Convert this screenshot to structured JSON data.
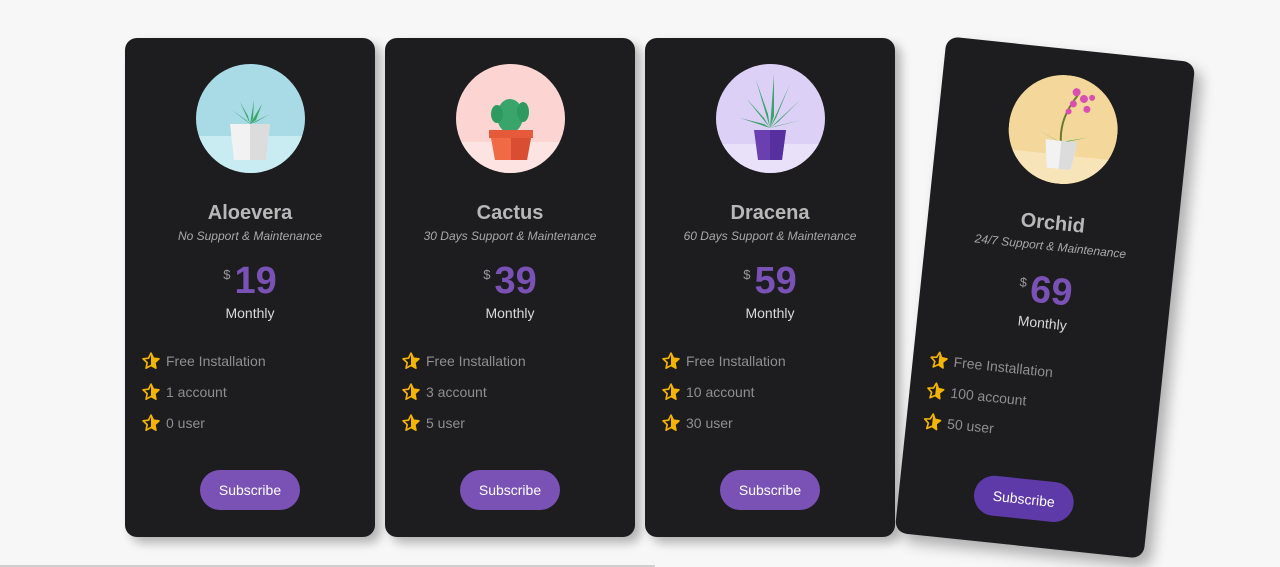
{
  "colors": {
    "card_bg": "#1d1c1e",
    "accent": "#7a52b5",
    "star": "#f5b400"
  },
  "plans": [
    {
      "name": "Aloevera",
      "support": "No Support & Maintenance",
      "currency": "$",
      "price": "19",
      "period": "Monthly",
      "image": "aloevera-plant-icon",
      "features": [
        "Free Installation",
        "1 account",
        "0 user"
      ],
      "button_label": "Subscribe"
    },
    {
      "name": "Cactus",
      "support": "30 Days Support & Maintenance",
      "currency": "$",
      "price": "39",
      "period": "Monthly",
      "image": "cactus-plant-icon",
      "features": [
        "Free Installation",
        "3 account",
        "5 user"
      ],
      "button_label": "Subscribe"
    },
    {
      "name": "Dracena",
      "support": "60 Days Support & Maintenance",
      "currency": "$",
      "price": "59",
      "period": "Monthly",
      "image": "dracena-plant-icon",
      "features": [
        "Free Installation",
        "10 account",
        "30 user"
      ],
      "button_label": "Subscribe"
    },
    {
      "name": "Orchid",
      "support": "24/7 Support & Maintenance",
      "currency": "$",
      "price": "69",
      "period": "Monthly",
      "image": "orchid-plant-icon",
      "features": [
        "Free Installation",
        "100 account",
        "50 user"
      ],
      "button_label": "Subscribe"
    }
  ]
}
